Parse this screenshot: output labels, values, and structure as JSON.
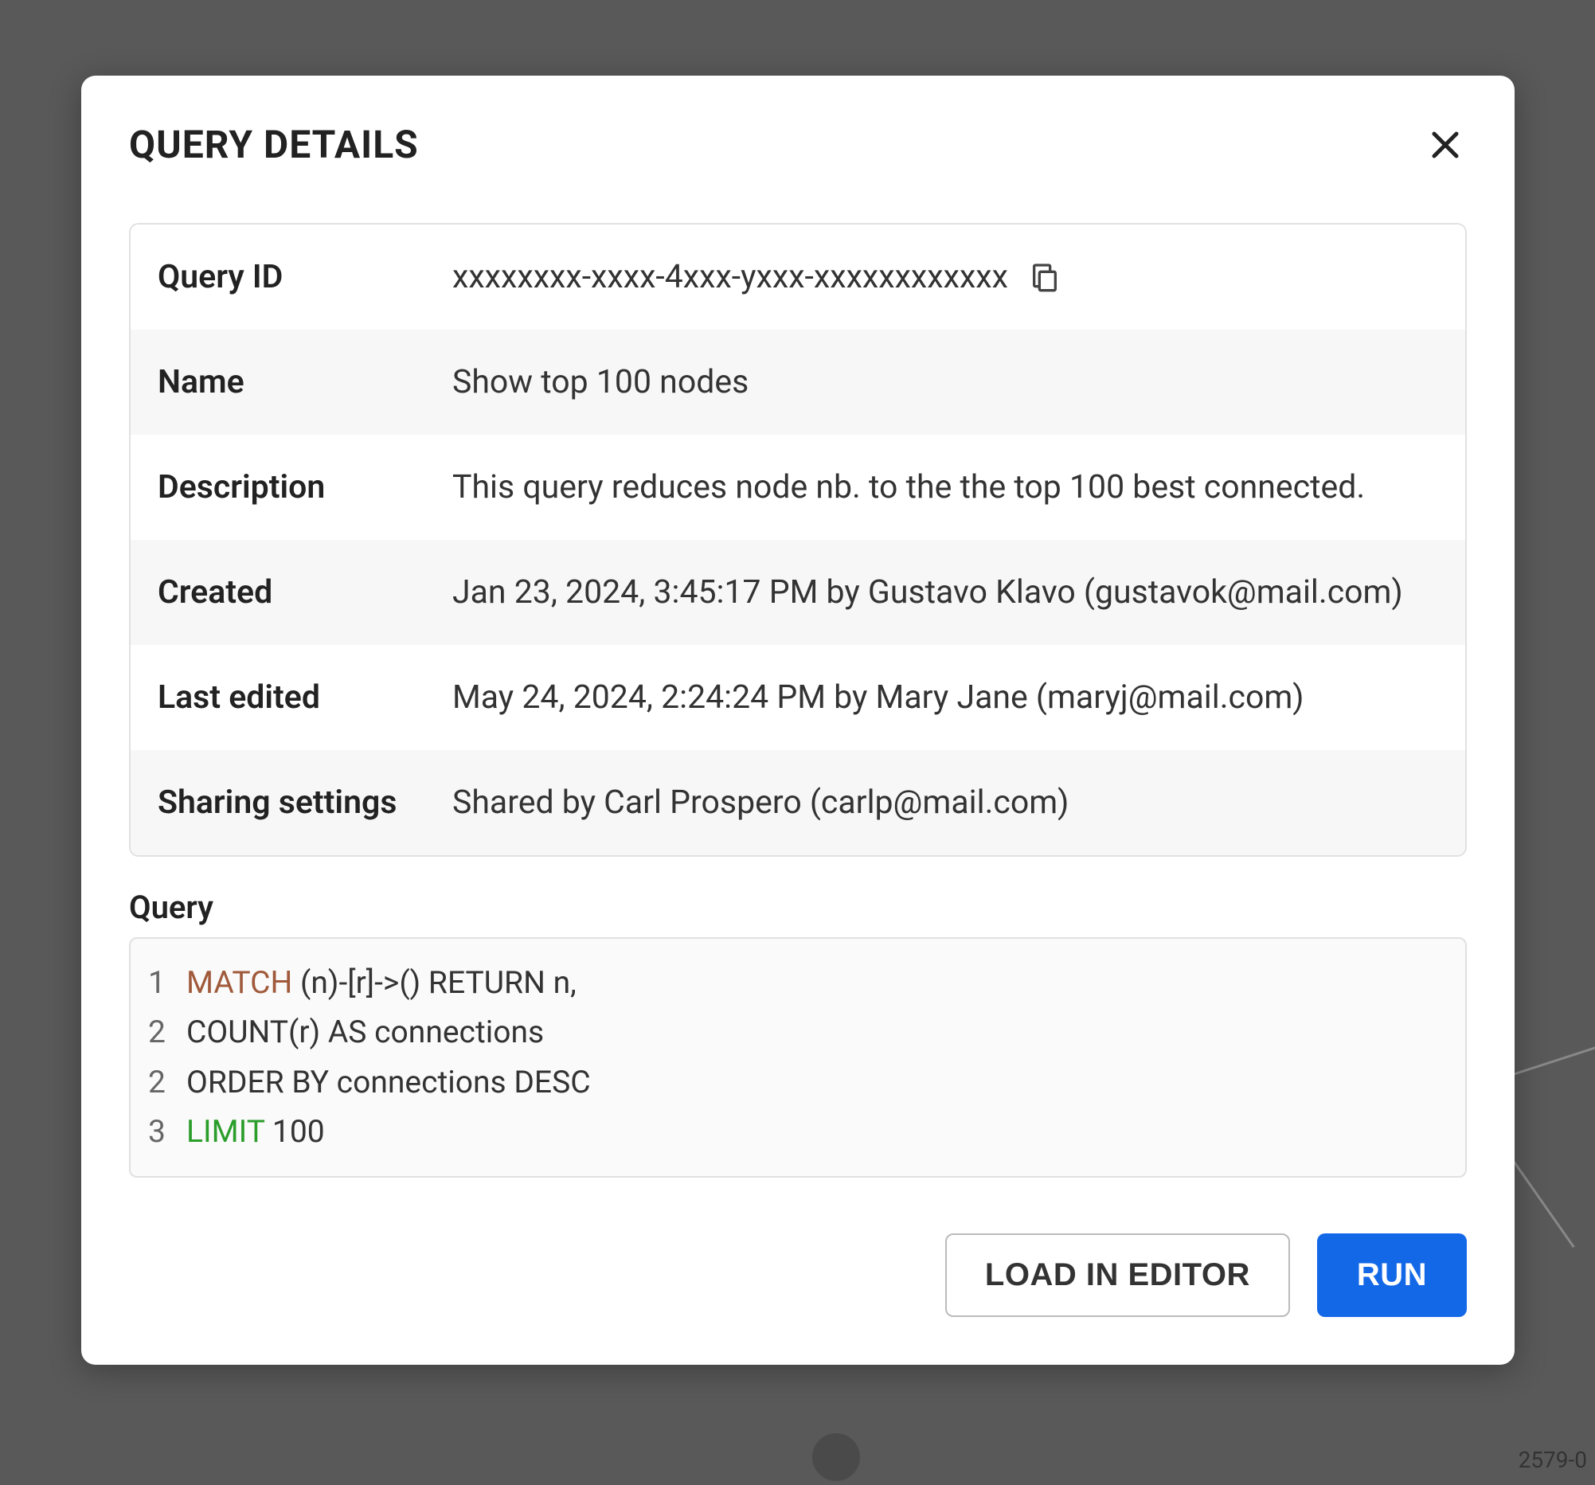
{
  "modal": {
    "title": "QUERY DETAILS",
    "rows": {
      "query_id": {
        "label": "Query ID",
        "value": "xxxxxxxx-xxxx-4xxx-yxxx-xxxxxxxxxxxx"
      },
      "name": {
        "label": "Name",
        "value": "Show top 100 nodes"
      },
      "description": {
        "label": "Description",
        "value": "This query reduces node nb. to the the top 100 best connected."
      },
      "created": {
        "label": "Created",
        "value": "Jan 23, 2024, 3:45:17 PM by Gustavo Klavo (gustavok@mail.com)"
      },
      "last_edited": {
        "label": "Last edited",
        "value": "May 24, 2024, 2:24:24 PM by Mary Jane (maryj@mail.com)"
      },
      "sharing": {
        "label": "Sharing settings",
        "value": "Shared by Carl Prospero (carlp@mail.com)"
      }
    },
    "query_section_label": "Query",
    "query_lines": [
      {
        "num": "1",
        "kw": "MATCH",
        "kw_class": "kw-match",
        "rest": " (n)-[r]->() RETURN n,"
      },
      {
        "num": "2",
        "kw": "",
        "kw_class": "",
        "rest": "COUNT(r) AS connections"
      },
      {
        "num": "2",
        "kw": "",
        "kw_class": "",
        "rest": "ORDER BY connections DESC"
      },
      {
        "num": "3",
        "kw": "LIMIT",
        "kw_class": "kw-limit",
        "rest": " 100"
      }
    ],
    "buttons": {
      "load": "LOAD IN EDITOR",
      "run": "RUN"
    }
  },
  "background": {
    "corner_label": "2579-0"
  }
}
